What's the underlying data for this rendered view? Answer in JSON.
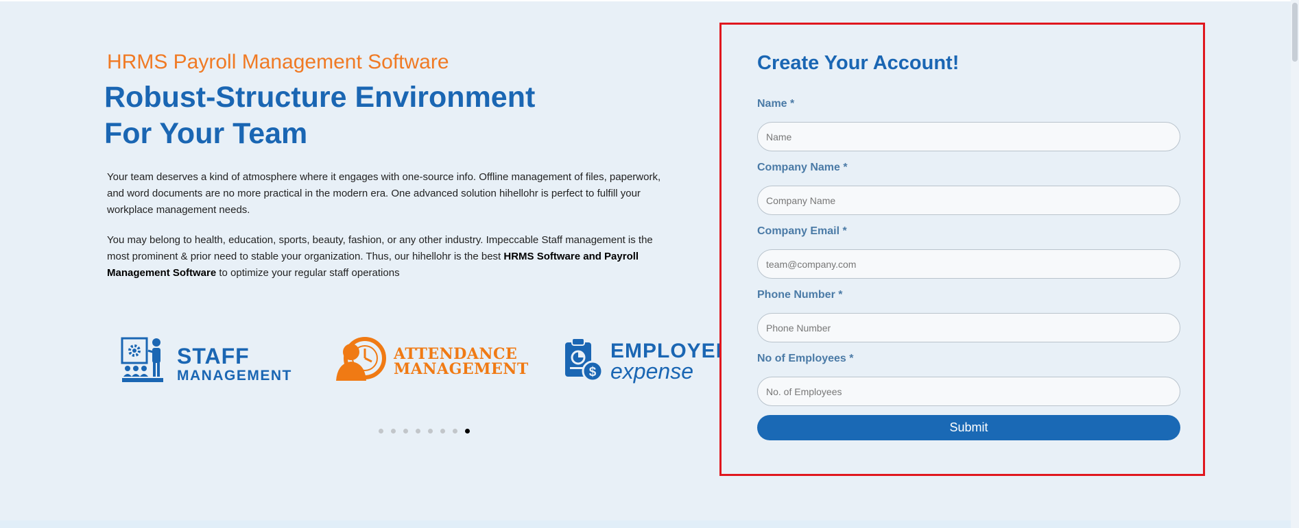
{
  "hero": {
    "eyebrow": "HRMS Payroll Management Software",
    "headline_line1": "Robust-Structure Environment",
    "headline_line2": "For Your Team",
    "paragraph1": "Your team deserves a kind of atmosphere where it engages with one-source info. Offline management of files, paperwork, and word documents are no more practical in the modern era. One advanced solution hihellohr is perfect to fulfill your workplace management needs.",
    "paragraph2_start": "You may belong to health, education, sports, beauty, fashion, or any other industry. Impeccable Staff management is the most prominent & prior need to stable your organization. Thus, our hihellohr is the best ",
    "paragraph2_bold": "HRMS Software and Payroll Management Software",
    "paragraph2_end": " to optimize your regular staff operations"
  },
  "features": [
    {
      "line1": "STAFF",
      "line2": "MANAGEMENT",
      "icon": "staff-presentation-icon"
    },
    {
      "line1": "ATTENDANCE",
      "line2": "MANAGEMENT",
      "icon": "attendance-clock-icon"
    },
    {
      "line1": "EMPLOYEE",
      "line2": "expense",
      "icon": "expense-clipboard-icon"
    }
  ],
  "carousel": {
    "dot_count": 8,
    "active_index": 7
  },
  "form": {
    "title": "Create Your Account!",
    "fields": [
      {
        "label": "Name *",
        "placeholder": "Name",
        "value": ""
      },
      {
        "label": "Company Name *",
        "placeholder": "Company Name",
        "value": ""
      },
      {
        "label": "Company Email *",
        "placeholder": "team@company.com",
        "value": ""
      },
      {
        "label": "Phone Number *",
        "placeholder": "Phone Number",
        "value": ""
      },
      {
        "label": "No of Employees *",
        "placeholder": "No. of Employees",
        "value": ""
      }
    ],
    "submit_label": "Submit"
  },
  "colors": {
    "accent_orange": "#f07a24",
    "primary_blue": "#1a66b3",
    "highlight_border": "#e0171e",
    "background": "#e8f0f7"
  }
}
